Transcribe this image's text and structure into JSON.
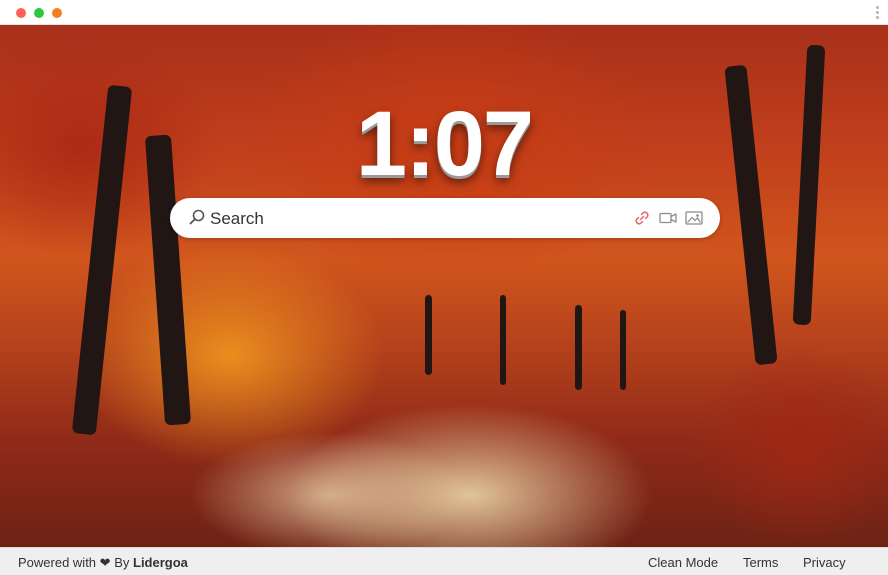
{
  "clock": {
    "time": "1:07"
  },
  "search": {
    "placeholder": "Search"
  },
  "tools": {
    "link_icon": "link-icon",
    "video_icon": "video-icon",
    "image_icon": "image-icon"
  },
  "footer": {
    "powered_prefix": "Powered with",
    "heart": "❤",
    "by": "By",
    "brand": "Lidergoa",
    "links": [
      "Clean Mode",
      "Terms",
      "Privacy"
    ]
  },
  "colors": {
    "link_icon": "#e5676b",
    "tool_icon": "#8c8c8c",
    "window_red": "#ff5f57",
    "window_green": "#28c840",
    "window_orange": "#f57c22"
  }
}
